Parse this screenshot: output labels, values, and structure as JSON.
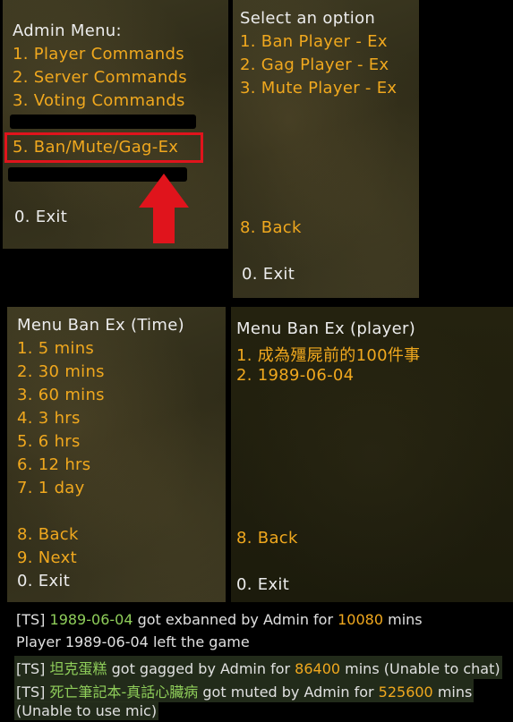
{
  "admin_menu": {
    "title": "Admin Menu:",
    "items": [
      {
        "label": "1. Player Commands"
      },
      {
        "label": "2. Server Commands"
      },
      {
        "label": "3. Voting Commands"
      },
      {
        "label": "5. Ban/Mute/Gag-Ex"
      }
    ],
    "exit": "0. Exit"
  },
  "option_menu": {
    "title": "Select an option",
    "items": [
      {
        "label": "1. Ban Player - Ex"
      },
      {
        "label": "2. Gag Player - Ex"
      },
      {
        "label": "3. Mute Player - Ex"
      }
    ],
    "back": "8. Back",
    "exit": "0. Exit"
  },
  "time_menu": {
    "title": "Menu Ban Ex (Time)",
    "items": [
      {
        "label": "1. 5 mins"
      },
      {
        "label": "2. 30 mins"
      },
      {
        "label": "3. 60 mins"
      },
      {
        "label": "4. 3 hrs"
      },
      {
        "label": "5. 6 hrs"
      },
      {
        "label": "6. 12 hrs"
      },
      {
        "label": "7. 1 day"
      }
    ],
    "back": "8. Back",
    "next": "9. Next",
    "exit": "0. Exit"
  },
  "player_menu": {
    "title": "Menu Ban Ex (player)",
    "items": [
      {
        "label": "1. 成為殭屍前的100件事"
      },
      {
        "label": "2. 1989-06-04"
      }
    ],
    "back": "8. Back",
    "exit": "0. Exit"
  },
  "chat_log": [
    {
      "tag": "[TS]",
      "name": "1989-06-04",
      "middle": " got exbanned by Admin for ",
      "amount": "10080",
      "tail": " mins"
    },
    {
      "plain": "Player 1989-06-04 left the game"
    },
    {
      "tag": "[TS]",
      "name": "坦克蛋糕",
      "middle": " got gagged by Admin for ",
      "amount": "86400",
      "tail": " mins (Unable to chat)"
    },
    {
      "tag": "[TS]",
      "name": "死亡筆記本-真話心臟病",
      "middle": " got muted by Admin for ",
      "amount": "525600",
      "tail": " mins"
    },
    {
      "plain": "(Unable to use mic)"
    }
  ],
  "colors": {
    "menu_item": "#f0a81e",
    "menu_title": "#ececec",
    "highlight": "#e0141c",
    "chat_name": "#8fce5a"
  }
}
